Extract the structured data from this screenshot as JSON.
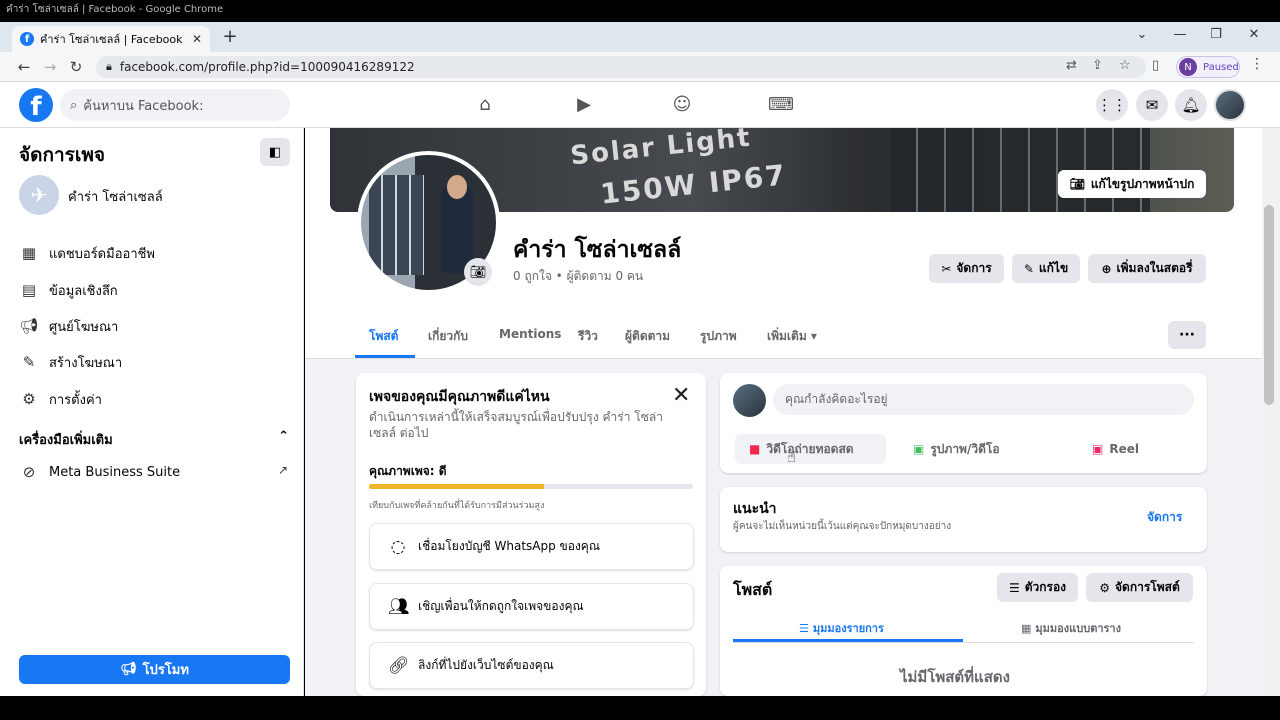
{
  "window": {
    "title": "คำร่า โซล่าเซลล์ | Facebook - Google Chrome"
  },
  "browser": {
    "tab_title": "คำร่า โซล่าเซลล์ | Facebook",
    "url": "facebook.com/profile.php?id=100090416289122",
    "profile_initial": "N",
    "profile_status": "Paused"
  },
  "header": {
    "search_placeholder": "ค้นหาบน Facebook:"
  },
  "sidebar": {
    "title": "จัดการเพจ",
    "page_name": "คำร่า โซล่าเซลล์",
    "items": [
      {
        "label": "แดชบอร์ดมืออาชีพ",
        "icon": "dashboard-icon"
      },
      {
        "label": "ข้อมูลเชิงลึก",
        "icon": "insights-icon"
      },
      {
        "label": "ศูนย์โฆษณา",
        "icon": "megaphone-icon"
      },
      {
        "label": "สร้างโฆษณา",
        "icon": "edit-icon"
      },
      {
        "label": "การตั้งค่า",
        "icon": "gear-icon"
      }
    ],
    "tools_title": "เครื่องมือเพิ่มเติม",
    "meta_label": "Meta Business Suite",
    "promote_label": "โปรโมท"
  },
  "cover": {
    "line1": "Solar Light",
    "line2": "150W IP67",
    "edit_label": "แก้ไขรูปภาพหน้าปก"
  },
  "profile": {
    "name": "คำร่า โซล่าเซลล์",
    "stats": "0 ถูกใจ • ผู้ติดตาม 0 คน",
    "manage_label": "จัดการ",
    "edit_label": "แก้ไข",
    "story_label": "เพิ่มลงในสตอรี่"
  },
  "tabs": [
    {
      "label": "โพสต์"
    },
    {
      "label": "เกี่ยวกับ"
    },
    {
      "label": "Mentions"
    },
    {
      "label": "รีวิว"
    },
    {
      "label": "ผู้ติดตาม"
    },
    {
      "label": "รูปภาพ"
    },
    {
      "label": "เพิ่มเติม ▾"
    }
  ],
  "quality_card": {
    "title": "เพจของคุณมีคุณภาพดีแค่ไหน",
    "desc": "ดำเนินการเหล่านี้ให้เสร็จสมบูรณ์เพื่อปรับปรุง คำร่า โซล่าเซลล์ ต่อไป",
    "quality_label": "คุณภาพเพจ: ดี",
    "progress": 0.54,
    "compare": "เทียบกับเพจที่คล้ายกันที่ได้รับการมีส่วนร่วมสูง",
    "actions": [
      {
        "label": "เชื่อมโยงบัญชี WhatsApp ของคุณ"
      },
      {
        "label": "เชิญเพื่อนให้กดถูกใจเพจของคุณ"
      },
      {
        "label": "ลิงก์ที่ไปยังเว็บไซต์ของคุณ"
      }
    ]
  },
  "composer": {
    "placeholder": "คุณกำลังคิดอะไรอยู่",
    "live_label": "วิดีโอถ่ายทอดสด",
    "photo_label": "รูปภาพ/วิดีโอ",
    "reel_label": "Reel"
  },
  "suggest": {
    "title": "แนะนำ",
    "subtitle": "ผู้คนจะไม่เห็นหน่วยนี้เว้นแต่คุณจะปักหมุดบางอย่าง",
    "manage": "จัดการ"
  },
  "posts": {
    "title": "โพสต์",
    "filter_label": "ตัวกรอง",
    "manage_label": "จัดการโพสต์",
    "list_view": "มุมมองรายการ",
    "grid_view": "มุมมองแบบตาราง",
    "empty": "ไม่มีโพสต์ที่แสดง"
  },
  "colors": {
    "brand": "#1877f2",
    "progress": "#f0b429"
  }
}
